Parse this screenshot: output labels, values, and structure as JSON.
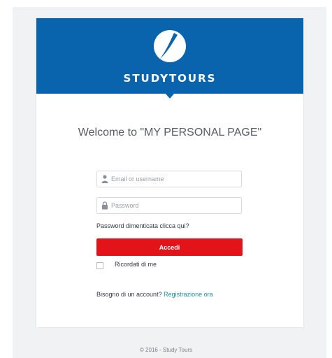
{
  "header": {
    "brand": "STUDYTOURS",
    "logo_icon": "globe-swoosh-icon",
    "color": "#0a64ad"
  },
  "main": {
    "welcome": "Welcome to \"MY PERSONAL PAGE\"",
    "email": {
      "icon": "user-icon",
      "placeholder": "Email or username",
      "value": ""
    },
    "password": {
      "icon": "lock-icon",
      "placeholder": "Password",
      "value": ""
    },
    "forgot_password": "Password dimenticata clicca qui?",
    "login_button": "Accedi",
    "login_button_color": "#e3131a",
    "remember_me": "Ricordati di me",
    "signup_prompt": "Bisogno di un account?",
    "signup_link": "Registrazione ora",
    "signup_link_color": "#1a8fa0"
  },
  "footer": {
    "copyright": "© 2016 - Study Tours"
  }
}
